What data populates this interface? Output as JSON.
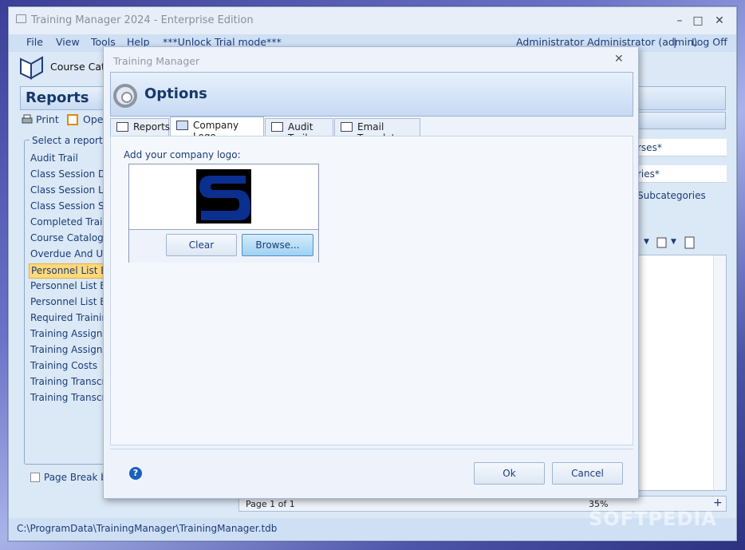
{
  "window": {
    "title": "Training Manager 2024 - Enterprise Edition",
    "controls": [
      "–",
      "□",
      "✕"
    ]
  },
  "menu": {
    "items": [
      "File",
      "View",
      "Tools",
      "Help",
      "***Unlock Trial mode***"
    ],
    "user": "Administrator Administrator (admin)",
    "separator": "|",
    "logoff": "Log Off"
  },
  "tabbar": {
    "course_catalog": "Course Catal"
  },
  "reports": {
    "header": "Reports",
    "toolbar": {
      "print": "Print",
      "open": "Oper"
    },
    "group_title": "Select a report",
    "items": [
      "Audit Trail",
      "Class Session Deta",
      "Class Session List",
      "Class Session Sum",
      "Completed Trainin",
      "Course Catalog",
      "Overdue And Upc",
      "Personnel List By",
      "Personnel List By",
      "Personnel List By",
      "Required Training",
      "Training Assignm",
      "Training Assignm",
      "Training Costs",
      "Training Transcrip",
      "Training Transcrip"
    ],
    "selected_index": 7,
    "page_break": "Page Break be"
  },
  "right": {
    "line1": "rses*",
    "line2": "ries*",
    "line3": "Subcategories"
  },
  "pager": {
    "page": "Page 1 of 1",
    "zoom": "35%"
  },
  "status_path": "C:\\ProgramData\\TrainingManager\\TrainingManager.tdb",
  "dialog": {
    "title": "Training Manager",
    "close": "✕",
    "header": "Options",
    "tabs": [
      "Reports",
      "Company Logo",
      "Audit Trail",
      "Email Template"
    ],
    "active_tab": "Company Logo",
    "logo_label": "Add your company logo:",
    "clear": "Clear",
    "browse": "Browse...",
    "ok": "Ok",
    "cancel": "Cancel",
    "help": "?"
  },
  "watermark": "SOFTPEDIA",
  "colors": {
    "accent": "#1c3c78",
    "selection": "#ffd97a",
    "logo_blue": "#0a2f8f"
  }
}
